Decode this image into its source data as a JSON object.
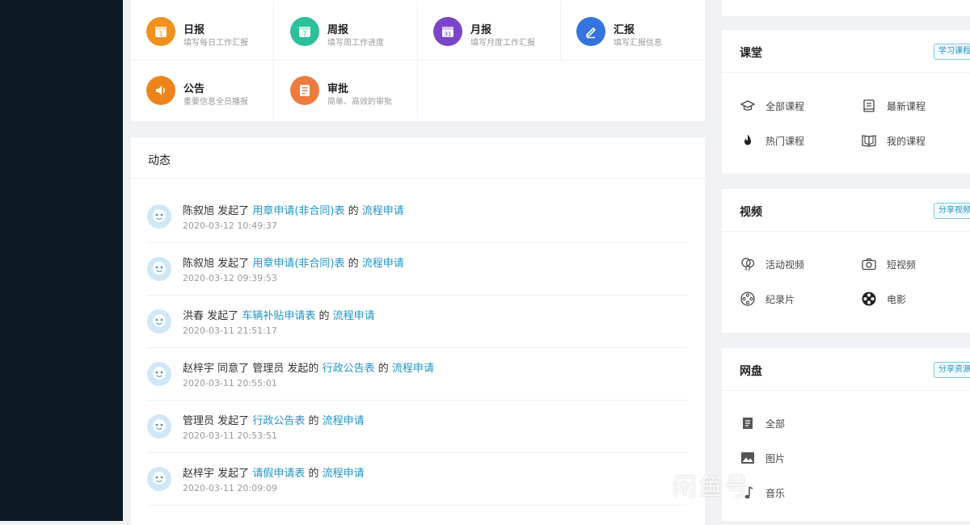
{
  "apps": [
    {
      "title": "日报",
      "desc": "填写每日工作汇报",
      "color": "#f0921d",
      "icon": "calendar-1-icon",
      "glyph": "1"
    },
    {
      "title": "周报",
      "desc": "填写周工作进度",
      "color": "#2cc09b",
      "icon": "calendar-7-icon",
      "glyph": "7"
    },
    {
      "title": "月报",
      "desc": "填写月度工作汇报",
      "color": "#7a45c9",
      "icon": "calendar-31-icon",
      "glyph": "31"
    },
    {
      "title": "汇报",
      "desc": "填写汇报信息",
      "color": "#3574e0",
      "icon": "pen-icon",
      "glyph": ""
    },
    {
      "title": "公告",
      "desc": "重要信息全员播报",
      "color": "#ec8419",
      "icon": "speaker-icon",
      "glyph": ""
    },
    {
      "title": "审批",
      "desc": "简单、高效的审批",
      "color": "#ec7c3d",
      "icon": "approval-icon",
      "glyph": ""
    }
  ],
  "activity": {
    "title": "动态",
    "items": [
      {
        "user": "陈叙旭",
        "verb": "发起了",
        "target": "用章申请(非合同)表",
        "of": "的",
        "link": "流程申请",
        "time": "2020-03-12 10:49:37"
      },
      {
        "user": "陈叙旭",
        "verb": "发起了",
        "target": "用章申请(非合同)表",
        "of": "的",
        "link": "流程申请",
        "time": "2020-03-12 09:39:53"
      },
      {
        "user": "洪春",
        "verb": "发起了",
        "target": "车辆补贴申请表",
        "of": "的",
        "link": "流程申请",
        "time": "2020-03-11 21:51:17"
      },
      {
        "user": "赵梓宇",
        "verb": "同意了 管理员 发起的",
        "target": "行政公告表",
        "of": "的",
        "link": "流程申请",
        "time": "2020-03-11 20:55:01"
      },
      {
        "user": "管理员",
        "verb": "发起了",
        "target": "行政公告表",
        "of": "的",
        "link": "流程申请",
        "time": "2020-03-11 20:53:51"
      },
      {
        "user": "赵梓宇",
        "verb": "发起了",
        "target": "请假申请表",
        "of": "的",
        "link": "流程申请",
        "time": "2020-03-11 20:09:09"
      }
    ]
  },
  "course": {
    "title": "课堂",
    "button": "学习课程",
    "items": [
      "全部课程",
      "最新课程",
      "热门课程",
      "我的课程"
    ]
  },
  "video": {
    "title": "视频",
    "button": "分享视频",
    "items": [
      "活动视频",
      "短视频",
      "纪录片",
      "电影"
    ]
  },
  "disk": {
    "title": "网盘",
    "button": "分享资源",
    "items": [
      "全部",
      "图片",
      "音乐"
    ]
  },
  "watermark": "闲鱼号"
}
